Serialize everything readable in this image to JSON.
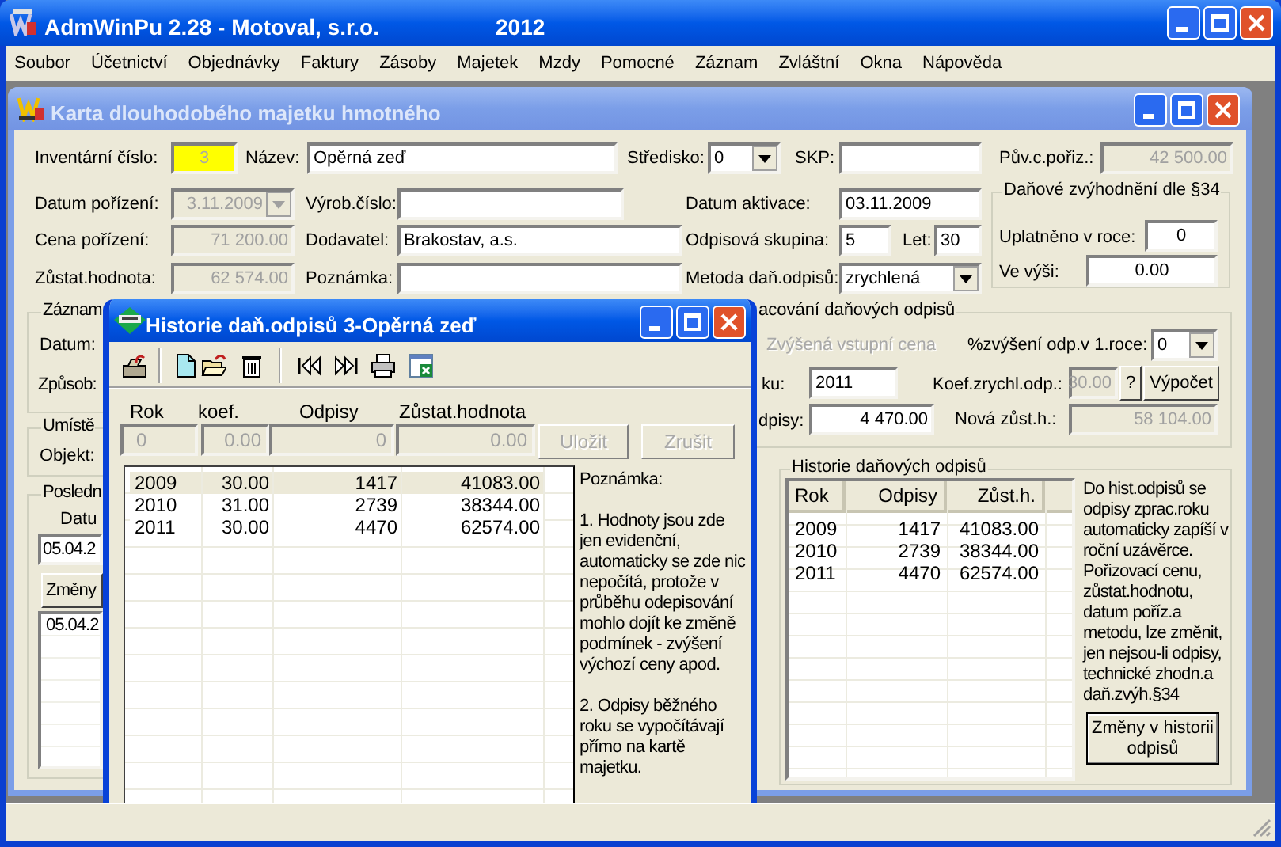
{
  "app": {
    "title": "AdmWinPu 2.28 - Motoval, s.r.o.",
    "year": "2012"
  },
  "menu": [
    "Soubor",
    "Účetnictví",
    "Objednávky",
    "Faktury",
    "Zásoby",
    "Majetek",
    "Mzdy",
    "Pomocné",
    "Záznam",
    "Zvláštní",
    "Okna",
    "Nápověda"
  ],
  "card": {
    "title": "Karta dlouhodobého majetku hmotného",
    "fields": [
      {
        "label": "Inventární číslo:",
        "value": "3",
        "kind": "highlight"
      },
      {
        "label": "Název:",
        "value": "Opěrná zeď",
        "kind": "text"
      },
      {
        "label": "Středisko:",
        "value": "0",
        "kind": "combo"
      },
      {
        "label": "SKP:",
        "kind": "text"
      },
      {
        "label": "Pův.c.pořiz.:",
        "value": "42 500.00",
        "kind": "disabled"
      },
      {
        "label": "Datum pořízení:",
        "value": "3.11.2009",
        "kind": "disabled_combo"
      },
      {
        "label": "Výrob.číslo:",
        "kind": "text"
      },
      {
        "label": "Datum aktivace:",
        "value": "03.11.2009",
        "kind": "text"
      },
      {
        "label": "Cena pořízení:",
        "value": "71 200.00",
        "kind": "disabled"
      },
      {
        "label": "Dodavatel:",
        "value": "Brakostav, a.s.",
        "kind": "text"
      },
      {
        "label": "Odpisová skupina:",
        "value": "5",
        "kind": "text"
      },
      {
        "label": "Let:",
        "value": "30",
        "kind": "text"
      },
      {
        "label": "Zůstat.hodnota:",
        "value": "62 574.00",
        "kind": "disabled"
      },
      {
        "label": "Poznámka:",
        "kind": "text"
      },
      {
        "label": "Metoda daň.odpisů:",
        "value": "zrychlená",
        "kind": "combo"
      }
    ],
    "tax_group": {
      "title": "Daňové zvýhodnění dle §34",
      "fields": [
        {
          "label": "Uplatněno v roce:",
          "value": "0",
          "kind": "text"
        },
        {
          "label": "Ve výši:",
          "value": "0.00",
          "kind": "text"
        }
      ]
    },
    "record_group": {
      "title": "Záznam",
      "labels": [
        "Datum:",
        "Způsob:"
      ]
    },
    "processing_group": {
      "title": "acování daňových odpisů",
      "checkbox": {
        "label": "Zvýšená vstupní cena",
        "disabled": true
      },
      "fields": [
        {
          "label": "%zvýšení odp.v 1.roce:",
          "value": "0",
          "kind": "combo"
        },
        {
          "label": "ku:",
          "value": "2011",
          "kind": "text"
        },
        {
          "label": "Koef.zrychl.odp.:",
          "value": "30.00",
          "kind": "disabled"
        },
        {
          "label": "dpisy:",
          "value": "4 470.00",
          "kind": "text"
        },
        {
          "label": "Nová zůst.h.:",
          "value": "58 104.00",
          "kind": "disabled"
        }
      ],
      "buttons": [
        "?",
        "Výpočet"
      ]
    },
    "location_group": {
      "title": "Umístě",
      "label": "Objekt:"
    },
    "last_group": {
      "title": "Posledn",
      "label": "Datu",
      "field": "05.04.2",
      "button": "Změny",
      "list": [
        "05.04.2"
      ]
    },
    "history_group": {
      "title": "Historie daňových odpisů",
      "columns": [
        "Rok",
        "Odpisy",
        "Zůst.h."
      ],
      "rows": [
        [
          "2009",
          "1417",
          "41083.00"
        ],
        [
          "2010",
          "2739",
          "38344.00"
        ],
        [
          "2011",
          "4470",
          "62574.00"
        ]
      ],
      "note": "Do hist.odpisů se odpisy zprac.roku automaticky zapíší v roční uzávěrce. Pořizovací cenu, zůstat.hodnotu, datum poříz.a metodu, lze změnit, jen nejsou-li odpisy, technické zhodn.a daň.zvýh.§34",
      "button": "Změny v historii odpisů"
    }
  },
  "dialog": {
    "title": "Historie daň.odpisů 3-Opěrná zeď",
    "columns": [
      "Rok",
      "koef.",
      "Odpisy",
      "Zůstat.hodnota"
    ],
    "inputs": [
      {
        "value": "0",
        "disabled": true
      },
      {
        "value": "0.00",
        "disabled": true
      },
      {
        "value": "0",
        "disabled": true
      },
      {
        "value": "0.00",
        "disabled": true
      }
    ],
    "buttons": [
      {
        "label": "Uložit",
        "disabled": true
      },
      {
        "label": "Zrušit",
        "disabled": true
      }
    ],
    "rows": [
      {
        "cells": [
          "2009",
          "30.00",
          "1417",
          "41083.00"
        ],
        "selected": true
      },
      {
        "cells": [
          "2010",
          "31.00",
          "2739",
          "38344.00"
        ],
        "selected": false
      },
      {
        "cells": [
          "2011",
          "30.00",
          "4470",
          "62574.00"
        ],
        "selected": false
      }
    ],
    "note": [
      "Poznámka:",
      "1. Hodnoty jsou zde jen evidenční, automaticky se zde nic nepočítá, protože v průběhu odepisování mohlo dojít ke změně podmínek - zvýšení výchozí ceny apod.",
      "2. Odpisy běžného roku se vypočítávají přímo na kartě majetku."
    ]
  }
}
